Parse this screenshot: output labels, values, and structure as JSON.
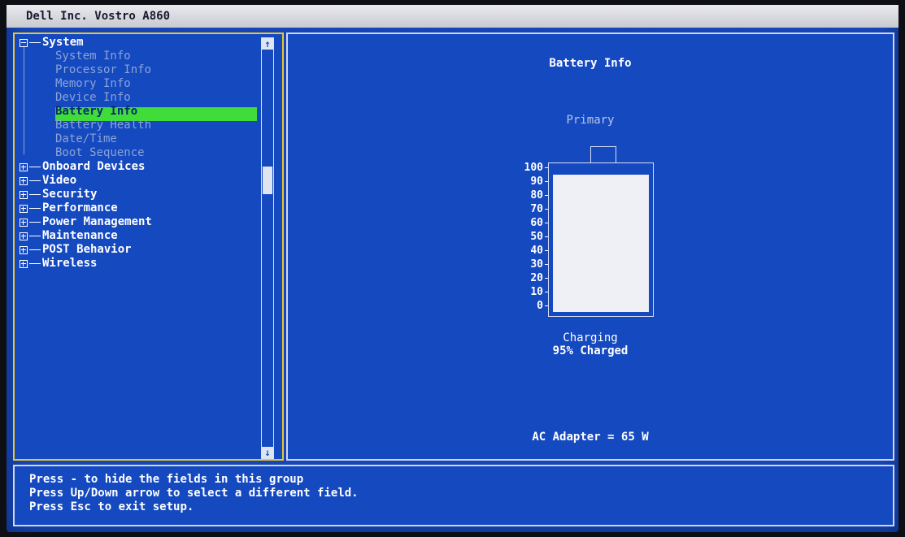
{
  "window": {
    "title": "Dell Inc. Vostro A860"
  },
  "tree": {
    "groups": [
      {
        "label": "System",
        "expanded": true
      },
      {
        "label": "Onboard Devices"
      },
      {
        "label": "Video"
      },
      {
        "label": "Security"
      },
      {
        "label": "Performance"
      },
      {
        "label": "Power Management"
      },
      {
        "label": "Maintenance"
      },
      {
        "label": "POST Behavior"
      },
      {
        "label": "Wireless"
      }
    ],
    "system_children": [
      "System Info",
      "Processor Info",
      "Memory Info",
      "Device Info",
      "Battery Info",
      "Battery Health",
      "Date/Time",
      "Boot Sequence"
    ],
    "selected": "Battery Info"
  },
  "scrollbar": {
    "up_arrow": "↑",
    "down_arrow": "↓"
  },
  "battery": {
    "title": "Battery Info",
    "battery_name": "Primary",
    "scale": [
      "100",
      "90",
      "80",
      "70",
      "60",
      "50",
      "40",
      "30",
      "20",
      "10",
      "0"
    ],
    "level_percent": 95,
    "status": "Charging",
    "charged_text": "95% Charged",
    "adapter_text": "AC Adapter = 65 W"
  },
  "help": {
    "line1_pre": "Press ",
    "line1_key": "-",
    "line1_post": " to hide the fields in this group",
    "line2_pre": "Press ",
    "line2_key": "Up/Down",
    "line2_post": " arrow to select a different field.",
    "line3_pre": "Press ",
    "line3_key": "Esc",
    "line3_post": " to exit setup."
  },
  "colors": {
    "background": "#1549c0",
    "selection": "#3fdc3a",
    "focus_border": "#e6c834"
  }
}
